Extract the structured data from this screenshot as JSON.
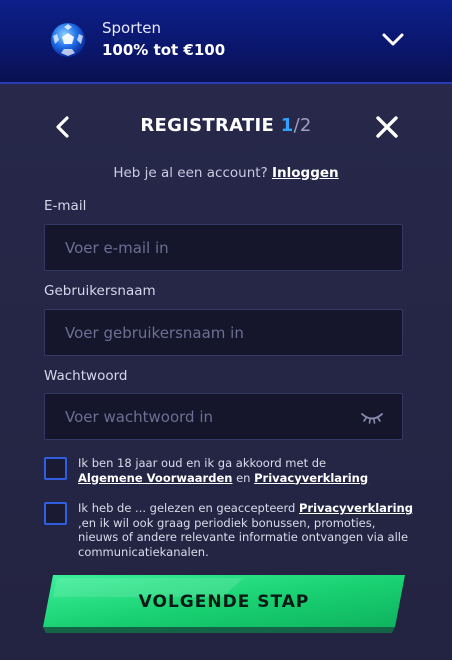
{
  "banner": {
    "title": "Sporten",
    "offer": "100% tot €100",
    "icon": "soccer-ball-icon"
  },
  "header": {
    "title": "REGISTRATIE",
    "step": "1",
    "total": "/2"
  },
  "login": {
    "prompt": "Heb je al een account?",
    "link": "Inloggen"
  },
  "fields": {
    "email": {
      "label": "E-mail",
      "placeholder": "Voer e-mail in",
      "value": ""
    },
    "username": {
      "label": "Gebruikersnaam",
      "placeholder": "Voer gebruikersnaam in",
      "value": ""
    },
    "password": {
      "label": "Wachtwoord",
      "placeholder": "Voer wachtwoord in",
      "value": ""
    }
  },
  "consent1": {
    "text_a": "Ik ben 18 jaar oud en ik ga akkoord met de",
    "link_a": "Algemene Voorwaarden",
    "text_b": "en",
    "link_b": "Privacyverklaring",
    "checked": false
  },
  "consent2": {
    "text_a": "Ik heb de ... gelezen en geaccepteerd",
    "link_a": "Privacyverklaring",
    "text_b": ",en ik wil ook graag periodiek bonussen, promoties, nieuws of andere relevante informatie ontvangen via alle communicatiekanalen.",
    "checked": false
  },
  "cta": {
    "label": "VOLGENDE STAP"
  },
  "colors": {
    "accent_blue": "#33a2ff",
    "cta_green": "#1fdc78",
    "checkbox_border": "#2f5fe0"
  }
}
